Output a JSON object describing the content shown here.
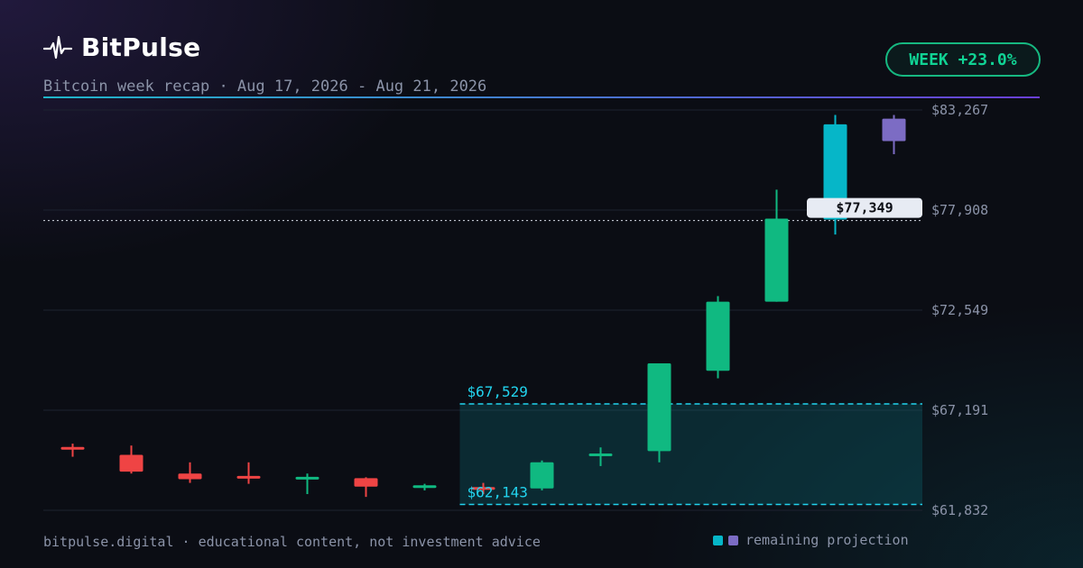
{
  "brand": {
    "name": "BitPulse",
    "icon": "pulse-icon"
  },
  "subtitle": "Bitcoin week recap · Aug 17, 2026 - Aug 21, 2026",
  "badge": {
    "text": "WEEK +23.0%"
  },
  "footer": {
    "text": "bitpulse.digital · educational content, not investment advice"
  },
  "legend": {
    "label": "remaining projection"
  },
  "colors": {
    "up": "#10b981",
    "down": "#ef4444",
    "projection_1": "#06b6c8",
    "projection_2": "#7c6cc4",
    "highlight_line": "#22d3ee"
  },
  "chart_data": {
    "type": "candlestick",
    "title": "",
    "ylim": [
      61832,
      83267
    ],
    "y_ticks": [
      "$83,267",
      "$77,908",
      "$72,549",
      "$67,191",
      "$61,832"
    ],
    "y_tick_values": [
      83267,
      77908,
      72549,
      67191,
      61832
    ],
    "current_price": {
      "value": 77349,
      "label": "$77,349"
    },
    "range_band": {
      "from_candle": 7,
      "high": {
        "value": 67529,
        "label": "$67,529"
      },
      "low": {
        "value": 62143,
        "label": "$62,143"
      }
    },
    "candles": [
      {
        "o": 65150,
        "h": 65400,
        "l": 64700,
        "c": 65150,
        "kind": "down"
      },
      {
        "o": 64800,
        "h": 65300,
        "l": 63800,
        "c": 63900,
        "kind": "down"
      },
      {
        "o": 63800,
        "h": 64400,
        "l": 63300,
        "c": 63500,
        "kind": "down"
      },
      {
        "o": 63600,
        "h": 64400,
        "l": 63250,
        "c": 63550,
        "kind": "down"
      },
      {
        "o": 63500,
        "h": 63800,
        "l": 62700,
        "c": 63550,
        "kind": "up"
      },
      {
        "o": 63550,
        "h": 63600,
        "l": 62550,
        "c": 63100,
        "kind": "down"
      },
      {
        "o": 63050,
        "h": 63250,
        "l": 62900,
        "c": 63100,
        "kind": "up"
      },
      {
        "o": 63000,
        "h": 63300,
        "l": 62700,
        "c": 62900,
        "kind": "down"
      },
      {
        "o": 63000,
        "h": 64500,
        "l": 62900,
        "c": 64400,
        "kind": "up"
      },
      {
        "o": 64700,
        "h": 65200,
        "l": 64200,
        "c": 64800,
        "kind": "up"
      },
      {
        "o": 65000,
        "h": 69300,
        "l": 64400,
        "c": 69700,
        "kind": "up"
      },
      {
        "o": 69300,
        "h": 73300,
        "l": 68900,
        "c": 73000,
        "kind": "up"
      },
      {
        "o": 73000,
        "h": 79000,
        "l": 73000,
        "c": 77450,
        "kind": "up"
      },
      {
        "o": 77400,
        "h": 83000,
        "l": 76600,
        "c": 82500,
        "kind": "projection_1"
      },
      {
        "o": 82800,
        "h": 83000,
        "l": 80900,
        "c": 81600,
        "kind": "projection_2"
      }
    ]
  }
}
